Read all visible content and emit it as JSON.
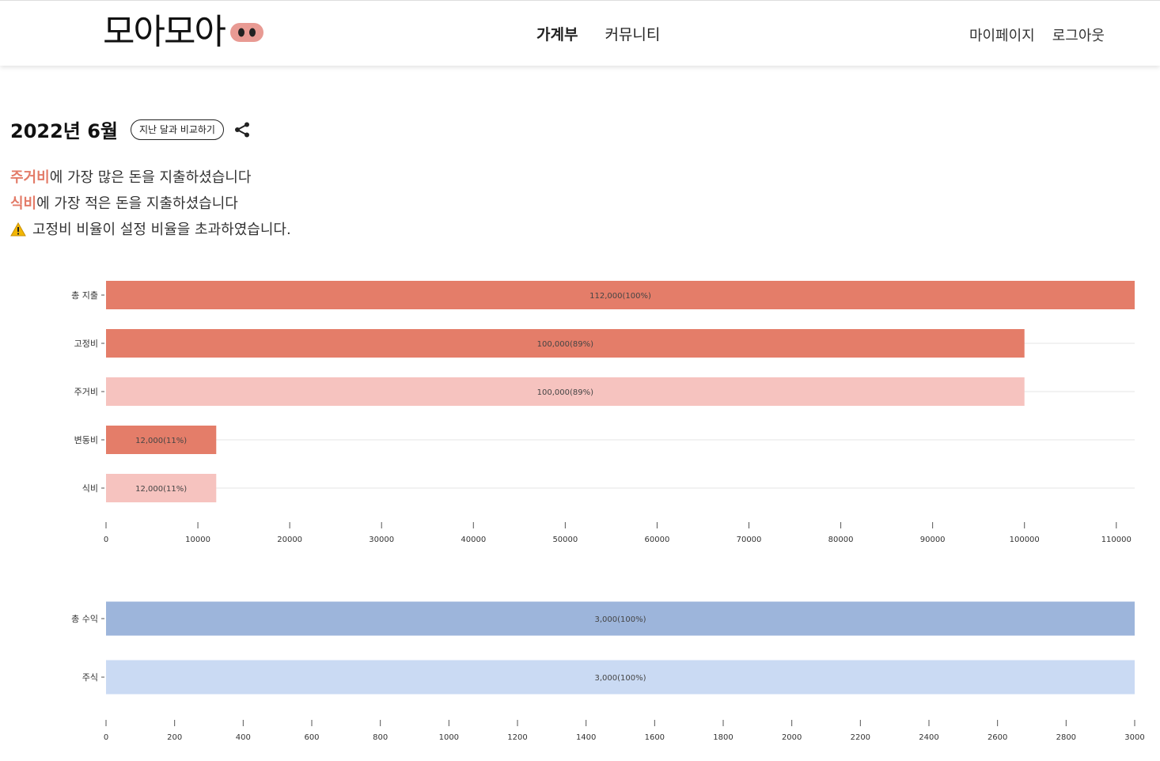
{
  "header": {
    "logo_text": "모아모아",
    "nav": [
      {
        "label": "가계부",
        "active": true
      },
      {
        "label": "커뮤니티",
        "active": false
      }
    ],
    "user_nav": [
      "마이페이지",
      "로그아웃"
    ]
  },
  "month": {
    "title": "2022년 6월",
    "compare_label": "지난 달과 비교하기"
  },
  "summary": {
    "most": {
      "category": "주거비",
      "text": "에 가장 많은 돈을 지출하셨습니다"
    },
    "least": {
      "category": "식비",
      "text": "에 가장 적은 돈을 지출하셨습니다"
    },
    "warning": "고정비 비율이 설정 비율을 초과하였습니다."
  },
  "colors": {
    "accent": "#e37b68",
    "expense_main": "#e47d69",
    "expense_sub": "#f6c3bf",
    "income_main": "#9db5db",
    "income_sub": "#cadaf3"
  },
  "chart_data": [
    {
      "type": "bar",
      "orientation": "horizontal",
      "categories": [
        "총 지출",
        "고정비",
        "주거비",
        "변동비",
        "식비"
      ],
      "values": [
        112000,
        100000,
        100000,
        12000,
        12000
      ],
      "labels": [
        "112,000(100%)",
        "100,000(89%)",
        "100,000(89%)",
        "12,000(11%)",
        "12,000(11%)"
      ],
      "bar_colors": [
        "#e47d69",
        "#e47d69",
        "#f6c3bf",
        "#e47d69",
        "#f6c3bf"
      ],
      "xlim": [
        0,
        112000
      ],
      "xticks": [
        0,
        10000,
        20000,
        30000,
        40000,
        50000,
        60000,
        70000,
        80000,
        90000,
        100000,
        110000
      ],
      "grid": true
    },
    {
      "type": "bar",
      "orientation": "horizontal",
      "categories": [
        "총 수익",
        "주식"
      ],
      "values": [
        3000,
        3000
      ],
      "labels": [
        "3,000(100%)",
        "3,000(100%)"
      ],
      "bar_colors": [
        "#9db5db",
        "#cadaf3"
      ],
      "xlim": [
        0,
        3000
      ],
      "xticks": [
        0,
        200,
        400,
        600,
        800,
        1000,
        1200,
        1400,
        1600,
        1800,
        2000,
        2200,
        2400,
        2600,
        2800,
        3000
      ],
      "grid": true
    }
  ]
}
